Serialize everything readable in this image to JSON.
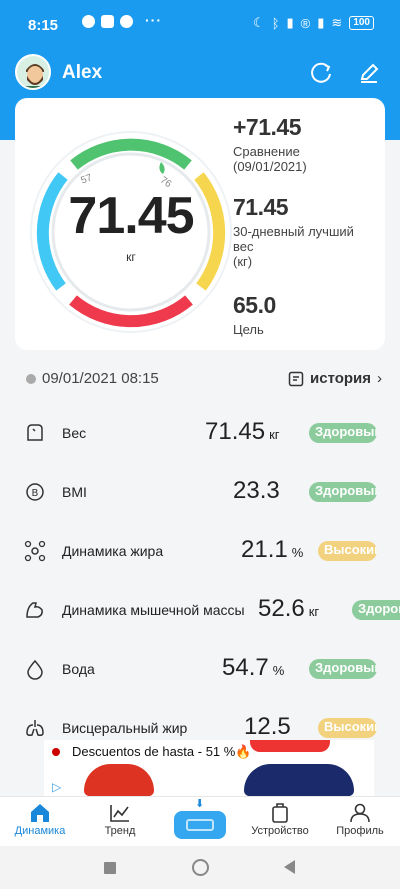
{
  "status_bar": {
    "time": "8:15",
    "battery": "100"
  },
  "header": {
    "username": "Alex"
  },
  "summary": {
    "weight_value": "71.45",
    "weight_unit": "кг",
    "tick_low": "57",
    "tick_high": "76",
    "comparison_value": "+71.45",
    "comparison_label": "Сравнение",
    "comparison_date": "(09/01/2021)",
    "best_value": "71.45",
    "best_label_1": "30-дневный лучший",
    "best_label_2": "вес",
    "best_label_3": "(кг)",
    "goal_value": "65.0",
    "goal_label": "Цель",
    "progress_fraction": 0.94
  },
  "datetime": "09/01/2021 08:15",
  "history_label": "история",
  "metrics": [
    {
      "label": "Вес",
      "value": "71.45",
      "unit": "кг",
      "badge": "Здоровый",
      "status": "green",
      "icon": "scale-icon"
    },
    {
      "label": "BMI",
      "value": "23.3",
      "unit": "",
      "badge": "Здоровый",
      "status": "green",
      "icon": "bmi-icon"
    },
    {
      "label": "Динамика жира",
      "value": "21.1",
      "unit": "%",
      "badge": "Высокий",
      "status": "yellow",
      "icon": "fat-icon"
    },
    {
      "label": "Динамика мышечной массы",
      "value": "52.6",
      "unit": "кг",
      "badge": "Здоров",
      "status": "green",
      "icon": "muscle-icon"
    },
    {
      "label": "Вода",
      "value": "54.7",
      "unit": "%",
      "badge": "Здоровый",
      "status": "green",
      "icon": "water-drop-icon"
    },
    {
      "label": "Висцеральный жир",
      "value": "12.5",
      "unit": "",
      "badge": "Высокий",
      "status": "yellow",
      "icon": "lungs-icon"
    }
  ],
  "ad": {
    "text": "Descuentos de hasta - 51 %🔥"
  },
  "tabs": [
    {
      "label": "Динамика",
      "active": true
    },
    {
      "label": "Тренд",
      "active": false
    },
    {
      "label": "Устройство",
      "active": false
    },
    {
      "label": "Профиль",
      "active": false
    }
  ],
  "colors": {
    "primary": "#1a9bf0",
    "healthy": "#8ccb9c",
    "high": "#f2d27e",
    "active_tab": "#1a87d9"
  }
}
